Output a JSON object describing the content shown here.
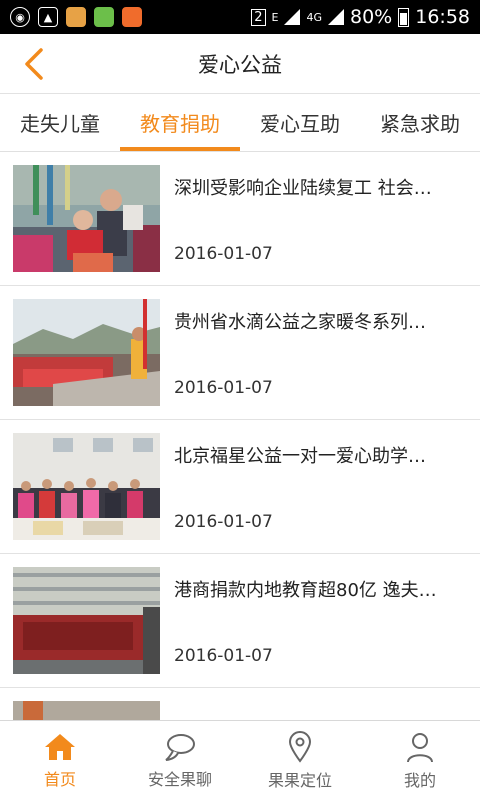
{
  "statusbar": {
    "sim": "2",
    "net_e": "E",
    "net_4g": "4G",
    "battery": "80%",
    "time": "16:58"
  },
  "header": {
    "title": "爱心公益",
    "back_icon": "chevron-left-icon",
    "accent": "#f28a1c"
  },
  "tabs": [
    {
      "label": "走失儿童",
      "active": false
    },
    {
      "label": "教育捐助",
      "active": true
    },
    {
      "label": "爱心互助",
      "active": false
    },
    {
      "label": "紧急求助",
      "active": false
    }
  ],
  "articles": [
    {
      "title": "深圳受影响企业陆续复工 社会…",
      "date": "2016-01-07"
    },
    {
      "title": "贵州省水滴公益之家暖冬系列…",
      "date": "2016-01-07"
    },
    {
      "title": "北京福星公益一对一爱心助学…",
      "date": "2016-01-07"
    },
    {
      "title": "港商捐款内地教育超80亿 逸夫…",
      "date": "2016-01-07"
    }
  ],
  "bottom_nav": [
    {
      "label": "首页",
      "icon": "home-icon",
      "active": true
    },
    {
      "label": "安全果聊",
      "icon": "chat-icon",
      "active": false
    },
    {
      "label": "果果定位",
      "icon": "location-pin-icon",
      "active": false
    },
    {
      "label": "我的",
      "icon": "user-icon",
      "active": false
    }
  ]
}
